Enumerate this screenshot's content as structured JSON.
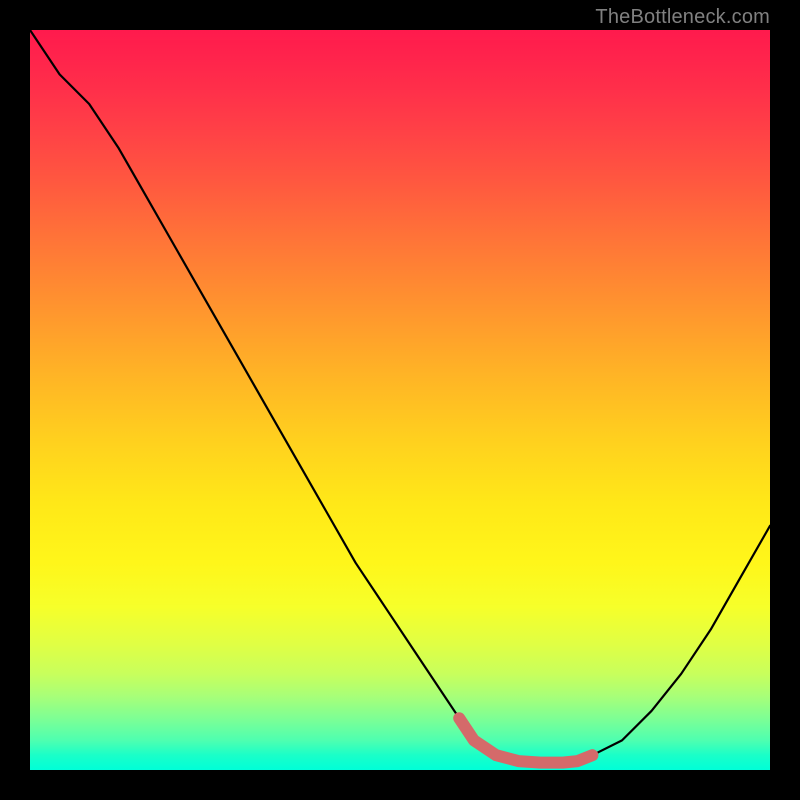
{
  "watermark": "TheBottleneck.com",
  "chart_data": {
    "type": "line",
    "title": "",
    "xlabel": "",
    "ylabel": "",
    "xlim": [
      0,
      100
    ],
    "ylim": [
      0,
      100
    ],
    "grid": false,
    "series": [
      {
        "name": "bottleneck-curve",
        "color": "#000000",
        "x": [
          0,
          4,
          8,
          12,
          16,
          20,
          24,
          28,
          32,
          36,
          40,
          44,
          48,
          52,
          56,
          58,
          60,
          63,
          66,
          69,
          72,
          74,
          76,
          80,
          84,
          88,
          92,
          96,
          100
        ],
        "y": [
          100,
          94,
          90,
          84,
          77,
          70,
          63,
          56,
          49,
          42,
          35,
          28,
          22,
          16,
          10,
          7,
          4,
          2,
          1.2,
          1.0,
          1.0,
          1.2,
          2,
          4,
          8,
          13,
          19,
          26,
          33
        ]
      },
      {
        "name": "sweet-spot-highlight",
        "color": "#d46a6a",
        "x": [
          58,
          60,
          63,
          66,
          69,
          72,
          74,
          76
        ],
        "y": [
          7,
          4,
          2,
          1.2,
          1.0,
          1.0,
          1.2,
          2
        ]
      }
    ]
  }
}
